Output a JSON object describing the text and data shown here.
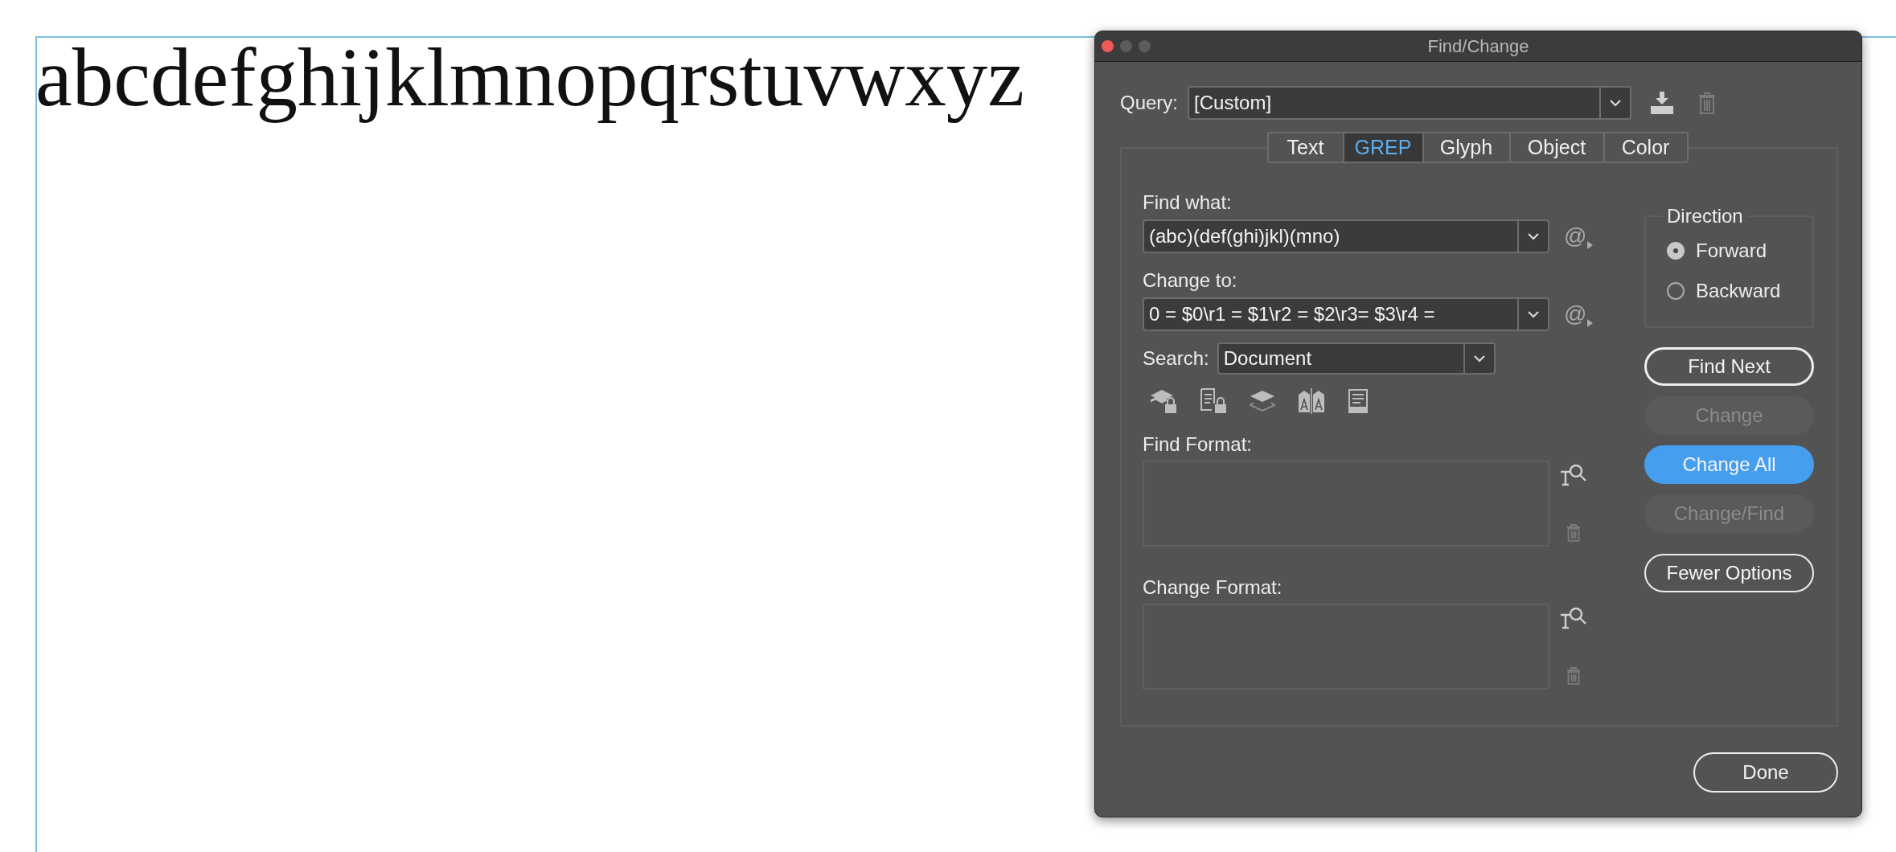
{
  "document": {
    "text": "abcdefghijklmnopqrstuvwxyz"
  },
  "dialog": {
    "title": "Find/Change",
    "query": {
      "label": "Query:",
      "value": "[Custom]"
    },
    "tabs": [
      {
        "label": "Text",
        "selected": false
      },
      {
        "label": "GREP",
        "selected": true
      },
      {
        "label": "Glyph",
        "selected": false
      },
      {
        "label": "Object",
        "selected": false
      },
      {
        "label": "Color",
        "selected": false
      }
    ],
    "find_what": {
      "label": "Find what:",
      "value": "(abc)(def(ghi)jkl)(mno)",
      "special_button": "@"
    },
    "change_to": {
      "label": "Change to:",
      "value": "0 = $0\\r1 = $1\\r2 = $2\\r3= $3\\r4 =",
      "special_button": "@"
    },
    "search": {
      "label": "Search:",
      "value": "Document"
    },
    "find_format": {
      "label": "Find Format:"
    },
    "change_format": {
      "label": "Change Format:"
    },
    "direction": {
      "label": "Direction",
      "options": [
        {
          "label": "Forward",
          "selected": true
        },
        {
          "label": "Backward",
          "selected": false
        }
      ]
    },
    "buttons": [
      {
        "label": "Find Next",
        "kind": "default",
        "disabled": false
      },
      {
        "label": "Change",
        "kind": "plain",
        "disabled": true
      },
      {
        "label": "Change All",
        "kind": "primary",
        "disabled": false
      },
      {
        "label": "Change/Find",
        "kind": "plain",
        "disabled": true
      },
      {
        "label": "Fewer Options",
        "kind": "plain",
        "disabled": false
      }
    ],
    "done": {
      "label": "Done"
    }
  }
}
